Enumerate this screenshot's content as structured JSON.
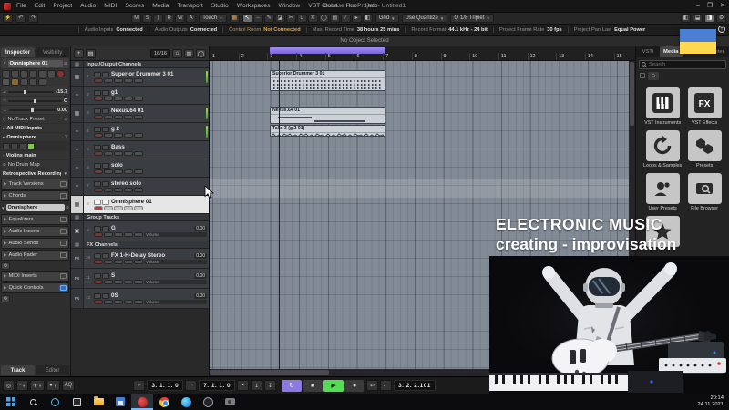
{
  "titlebar": {
    "title": "Cubase Pro Project - Untitled1",
    "menus": [
      "File",
      "Edit",
      "Project",
      "Audio",
      "MIDI",
      "Scores",
      "Media",
      "Transport",
      "Studio",
      "Workspaces",
      "Window",
      "VST Cloud",
      "Hub",
      "Help"
    ],
    "minimize_glyph": "–",
    "maximize_glyph": "❐",
    "close_glyph": "✕"
  },
  "toolbar": {
    "activate_glyph": "⚡",
    "undo_glyph": "↶",
    "redo_glyph": "↷",
    "state_buttons": [
      "M",
      "S",
      "|",
      "R",
      "W",
      "A"
    ],
    "automation_mode": "Touch",
    "tools": [
      {
        "glyph": "↖",
        "active": true
      },
      {
        "glyph": "⇔"
      },
      {
        "glyph": "✎"
      },
      {
        "glyph": "◪"
      },
      {
        "glyph": "✂"
      },
      {
        "glyph": "∪"
      },
      {
        "glyph": "✕"
      },
      {
        "glyph": "◯"
      },
      {
        "glyph": "▤"
      },
      {
        "glyph": "∕"
      },
      {
        "glyph": "▸"
      },
      {
        "glyph": "◧"
      }
    ],
    "snap_label": "Grid",
    "quantize_label": "Use Quantize",
    "q_badge": "Q",
    "quantize_value": "1/8 Triplet",
    "gear_glyph": "⚙"
  },
  "status_line": {
    "segments": [
      {
        "label": "Audio Inputs",
        "value": "Connected"
      },
      {
        "label": "Audio Outputs",
        "value": "Connected"
      },
      {
        "label": "Control Room",
        "value": "Not Connected",
        "highlight": true
      },
      {
        "label": "Max. Record Time",
        "value": "38 hours 25 mins"
      },
      {
        "label": "Record Format",
        "value": "44.1 kHz - 24 bit"
      },
      {
        "label": "Project Frame Rate",
        "value": "30 fps"
      },
      {
        "label": "Project Pan Law",
        "value": "Equal Power"
      }
    ]
  },
  "info_line": {
    "text": "No Object Selected"
  },
  "inspector": {
    "tabs": [
      {
        "label": "Inspector",
        "active": true
      },
      {
        "label": "Visibility"
      }
    ],
    "track_name": "Omnisphere 01",
    "volume": "-15.7",
    "pan": "C",
    "delay": "0.00",
    "track_preset": "No Track Preset",
    "input_routing": "All MIDI Inputs",
    "output_routing": "Omnisphere",
    "midi_channel": "2",
    "expression_map": "Violins main",
    "drum_map": "No Drum Map",
    "retrospective": "Retrospective Recording",
    "sections_top": [
      {
        "label": "Track Versions"
      },
      {
        "label": "Chords"
      }
    ],
    "instrument_slot": "Omnisphere",
    "sections_mid": [
      {
        "label": "Equalizers"
      },
      {
        "label": "Audio Inserts"
      },
      {
        "label": "Audio Sends"
      },
      {
        "label": "Audio Fader"
      }
    ],
    "sections_bottom": [
      {
        "label": "MIDI Inserts"
      },
      {
        "label": "Quick Controls",
        "active": true
      }
    ],
    "bottom_tabs": [
      {
        "label": "Track",
        "active": true
      },
      {
        "label": "Editor"
      }
    ]
  },
  "track_list": {
    "add_glyph": "+",
    "counter": "16/16",
    "rows": [
      {
        "type": "folder",
        "name": "Input/Output Channels"
      },
      {
        "type": "instrument",
        "num": "1",
        "name": "Superior Drummer 3 01",
        "meter": true
      },
      {
        "type": "audio",
        "num": "2",
        "name": "g1"
      },
      {
        "type": "instrument",
        "num": "3",
        "name": "Nexus.64 01",
        "meter": true
      },
      {
        "type": "audio",
        "num": "4",
        "name": "g 2",
        "meter": true
      },
      {
        "type": "audio",
        "num": "5",
        "name": "Bass"
      },
      {
        "type": "audio",
        "num": "6",
        "name": "solo"
      },
      {
        "type": "audio",
        "num": "7",
        "name": "stereo solo"
      },
      {
        "type": "instrument",
        "num": "8",
        "name": "Omnisphere 01",
        "selected": true
      },
      {
        "type": "folder",
        "name": "Group Tracks"
      },
      {
        "type": "group",
        "num": "9",
        "name": "G",
        "gain": "0.00",
        "fader": "Volume"
      },
      {
        "type": "folder",
        "name": "FX Channels"
      },
      {
        "type": "fx",
        "num": "10",
        "name": "FX 1-H-Delay Stereo",
        "gain": "0.00",
        "fader": "Volume"
      },
      {
        "type": "fx",
        "num": "11",
        "name": "S",
        "gain": "0.00",
        "fader": "Volume"
      },
      {
        "type": "fx",
        "num": "12",
        "name": "0S",
        "gain": "0.00",
        "fader": "Volume"
      }
    ]
  },
  "ruler": {
    "bars": [
      "1",
      "2",
      "3",
      "4",
      "5",
      "6",
      "7",
      "8",
      "9",
      "10",
      "11",
      "12",
      "13",
      "14",
      "15"
    ]
  },
  "arrangement": {
    "clips": [
      {
        "name": "Superior Drummer 3 01"
      },
      {
        "name": "Nexus.64 01"
      },
      {
        "name": "Take 3 (g 2 01)"
      }
    ]
  },
  "right_panel": {
    "tabs": [
      {
        "label": "VSTi"
      },
      {
        "label": "Media",
        "active": true
      },
      {
        "label": "CR"
      },
      {
        "label": "Meter"
      }
    ],
    "search_placeholder": "Search",
    "home_glyph": "⌂",
    "tiles": [
      {
        "label": "VST Instruments",
        "icon": "piano-icon"
      },
      {
        "label": "VST Effects",
        "icon": "fx-icon"
      },
      {
        "label": "Loops & Samples",
        "icon": "loop-icon"
      },
      {
        "label": "Presets",
        "icon": "hexagons-icon"
      },
      {
        "label": "User Presets",
        "icon": "user-icon"
      },
      {
        "label": "File Browser",
        "icon": "file-search-icon"
      }
    ],
    "favorites_icon": "star-icon"
  },
  "transport": {
    "metronome_glyph": "◎",
    "aq_label": "AQ",
    "left_locator": "3. 1. 1. 0",
    "right_locator": "7. 1. 1. 0",
    "cycle_glyph": "↻",
    "stop_glyph": "■",
    "play_glyph": "▶",
    "record_glyph": "●",
    "return_glyph": "↩",
    "note_glyph": "♩",
    "time": "3. 2. 2.101"
  },
  "taskbar": {
    "icons": [
      "windows-start-icon",
      "search-icon",
      "cortana-icon",
      "task-view-icon",
      "file-explorer-icon",
      "floppy-app-icon",
      "cubase-app-icon",
      "chrome-icon",
      "edge-icon",
      "obs-icon",
      "camera-app-icon"
    ],
    "clock_time": "20:14",
    "clock_date": "24.11.2021"
  },
  "video_overlay": {
    "caption_line1": "ELECTRONIC MUSIC",
    "caption_line2": "creating - improvisation"
  },
  "colors": {
    "accent_purple": "#8d7ae0",
    "play_green": "#55dc55",
    "record_red": "#c03636",
    "warn_orange": "#e8a43c",
    "flag_blue": "#4a7fd4",
    "flag_yellow": "#ffd84d",
    "arrange_bg": "#828a96",
    "selected_track_bg": "#e6e6e6"
  }
}
